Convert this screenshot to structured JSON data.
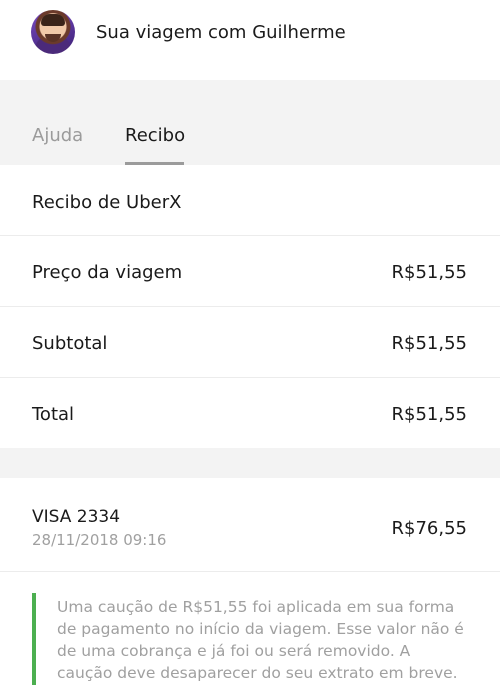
{
  "header": {
    "title": "Sua viagem com Guilherme"
  },
  "tabs": [
    {
      "label": "Ajuda",
      "active": false
    },
    {
      "label": "Recibo",
      "active": true
    }
  ],
  "receipt": {
    "heading": "Recibo de UberX",
    "lines": [
      {
        "label": "Preço da viagem",
        "amount": "R$51,55"
      },
      {
        "label": "Subtotal",
        "amount": "R$51,55"
      },
      {
        "label": "Total",
        "amount": "R$51,55"
      }
    ]
  },
  "payment": {
    "card": "VISA 2334",
    "date": "28/11/2018 09:16",
    "amount": "R$76,55"
  },
  "notice": {
    "text": "Uma caução de R$51,55 foi aplicada em sua forma de pagamento no início da viagem. Esse valor não é de uma cobrança e já foi ou será removido. A caução deve desaparecer do seu extrato em breve."
  },
  "colors": {
    "accent": "#4caf50",
    "muted": "#a0a0a0",
    "background_gray": "#f3f3f3"
  }
}
